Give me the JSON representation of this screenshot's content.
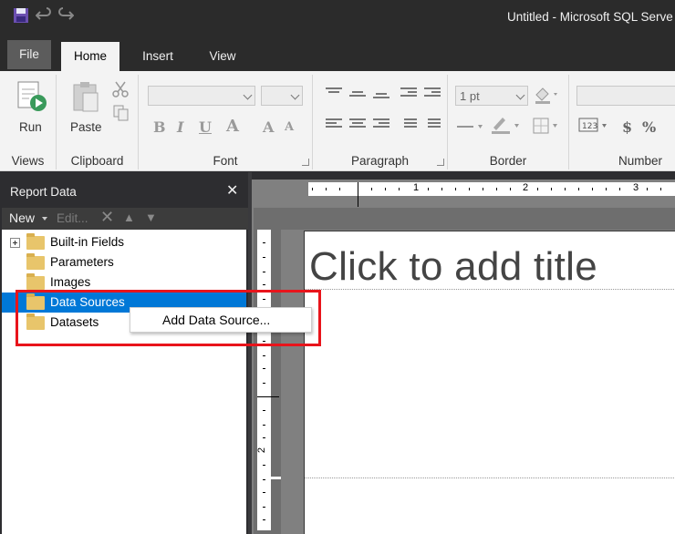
{
  "app": {
    "window_title": "Untitled - Microsoft SQL Serve"
  },
  "ribbon": {
    "tabs": [
      {
        "label": "File"
      },
      {
        "label": "Home"
      },
      {
        "label": "Insert"
      },
      {
        "label": "View"
      }
    ],
    "groups": {
      "views": {
        "label": "Views",
        "run_label": "Run"
      },
      "clipboard": {
        "label": "Clipboard",
        "paste_label": "Paste"
      },
      "font": {
        "label": "Font"
      },
      "paragraph": {
        "label": "Paragraph"
      },
      "border": {
        "label": "Border",
        "width_value": "1 pt"
      },
      "number": {
        "label": "Number"
      }
    }
  },
  "report_data": {
    "title": "Report Data",
    "toolbar": {
      "new_label": "New",
      "edit_label": "Edit..."
    },
    "tree": [
      {
        "label": "Built-in Fields",
        "expandable": true
      },
      {
        "label": "Parameters",
        "expandable": false
      },
      {
        "label": "Images",
        "expandable": false
      },
      {
        "label": "Data Sources",
        "expandable": false,
        "selected": true
      },
      {
        "label": "Datasets",
        "expandable": false
      }
    ]
  },
  "context_menu": {
    "items": [
      {
        "label": "Add Data Source..."
      }
    ]
  },
  "design_surface": {
    "title_placeholder": "Click to add title",
    "ruler_h": [
      "1",
      "2",
      "3"
    ],
    "ruler_v": [
      "2"
    ]
  },
  "colors": {
    "selection": "#0078d7",
    "highlight_box": "#e8141b",
    "chrome_dark": "#2b2b2b"
  }
}
